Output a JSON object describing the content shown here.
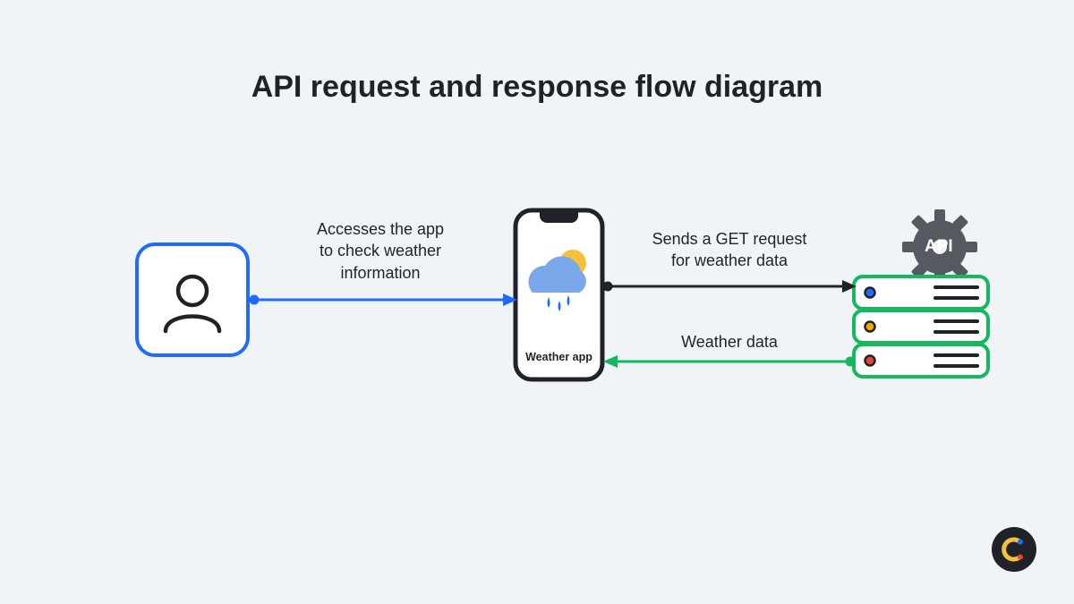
{
  "title": "API request and response flow diagram",
  "nodes": {
    "user": {
      "name": "User"
    },
    "app": {
      "name": "Weather app",
      "caption": "Weather app"
    },
    "server": {
      "name": "API server",
      "api_label": "API"
    }
  },
  "edges": {
    "user_to_app": {
      "label_line1": "Accesses the app",
      "label_line2": "to check weather",
      "label_line3": "information"
    },
    "app_to_server": {
      "label_line1": "Sends a GET request",
      "label_line2": "for weather data"
    },
    "server_to_app": {
      "label_line1": "Weather data"
    }
  },
  "colors": {
    "bg": "#f1f4f6",
    "blue": "#1f6bff",
    "green": "#15b85f",
    "dark": "#1f2328",
    "line_gray": "#3a3f46",
    "yellow": "#f6c13a",
    "cloud": "#7aa7ea",
    "gear": "#565a60",
    "red": "#e34536",
    "amber": "#f0a800"
  }
}
